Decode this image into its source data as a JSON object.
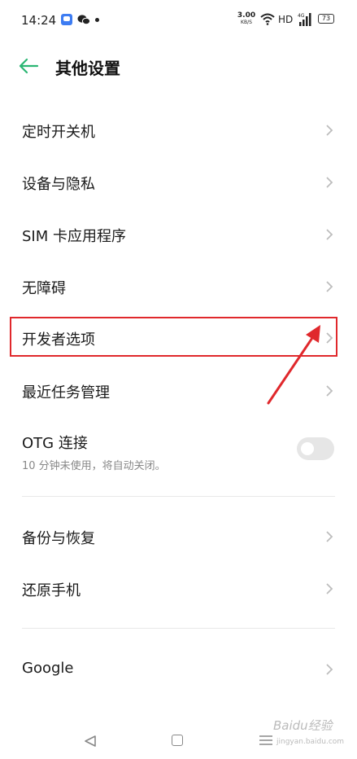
{
  "status_bar": {
    "time": "14:24",
    "net_speed_value": "3.00",
    "net_speed_unit": "KB/S",
    "hd_label": "HD",
    "battery_level": "73"
  },
  "header": {
    "title": "其他设置"
  },
  "items": [
    {
      "label": "定时开关机"
    },
    {
      "label": "设备与隐私"
    },
    {
      "label": "SIM 卡应用程序"
    },
    {
      "label": "无障碍"
    },
    {
      "label": "开发者选项"
    },
    {
      "label": "最近任务管理"
    },
    {
      "label": "OTG 连接",
      "sub": "10 分钟未使用，将自动关闭。",
      "toggle_on": false
    },
    {
      "label": "备份与恢复"
    },
    {
      "label": "还原手机"
    },
    {
      "label": "Google"
    }
  ],
  "annotation": {
    "highlight_color": "#e0282c",
    "highlighted_item": "开发者选项"
  },
  "watermark": {
    "text": "Baidu经验",
    "sub": "jingyan.baidu.com"
  },
  "colors": {
    "accent_green": "#2bb673",
    "annotation_red": "#e0282c"
  }
}
